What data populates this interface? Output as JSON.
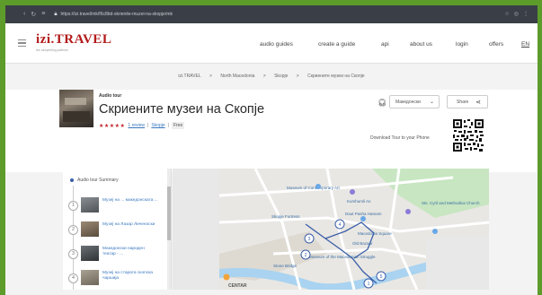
{
  "browser": {
    "url": "https://izi.travel/mk/f6c8bd-skrienite-muzei-na-skopje/mk"
  },
  "header": {
    "logo_main": "izi.TRAVEL",
    "logo_sub": "the storytelling platform",
    "nav": [
      "audio guides",
      "create a guide",
      "api",
      "about us",
      "login",
      "offers",
      "EN"
    ]
  },
  "breadcrumbs": [
    "izi.TRAVEL",
    ">",
    "North Macedonia",
    ">",
    "Skopje",
    ">",
    "Скриените музеи на Скопје"
  ],
  "tour": {
    "type_label": "Audio tour",
    "title": "Скриените музеи на Скопје",
    "stars": "★★★★★",
    "rating_link": "1 review",
    "genre_link": "Skopje",
    "separator": "|",
    "price_badge": "Free",
    "language_selected": "Македонски",
    "share_label": "Share",
    "download_text": "Download Tour to your Phone"
  },
  "sidebar": {
    "summary_label": "Audio tour Summary",
    "stops": [
      {
        "num": "1",
        "label": "Музеј на ... македонската ...",
        "thumb_color": "#6b6f73"
      },
      {
        "num": "2",
        "label": "Музеј на Лазар Личеноски",
        "thumb_color": "#7a6a58"
      },
      {
        "num": "3",
        "label": "Македонски народен театар - ...",
        "thumb_color": "#4f5558"
      },
      {
        "num": "4",
        "label": "Музеј на старата скопска чаршија",
        "thumb_color": "#8c8477"
      }
    ]
  },
  "map": {
    "labels": [
      "Museum of Contemporary Art",
      "Kurshumli An",
      "Daut Pasha Hamam",
      "Skopje Fortress",
      "Old Bazaar",
      "Stone Bridge",
      "Museum of the Macedonian Struggle",
      "Macedonia Square",
      "Sts. Cyril and Methodius Church",
      "CENTAR"
    ],
    "markers": [
      "4",
      "3",
      "2",
      "1",
      "5"
    ],
    "water_color": "#a9d3f0",
    "road_color": "#ffffff",
    "park_color": "#c7e6c1",
    "route_color": "#3a5ea8"
  }
}
